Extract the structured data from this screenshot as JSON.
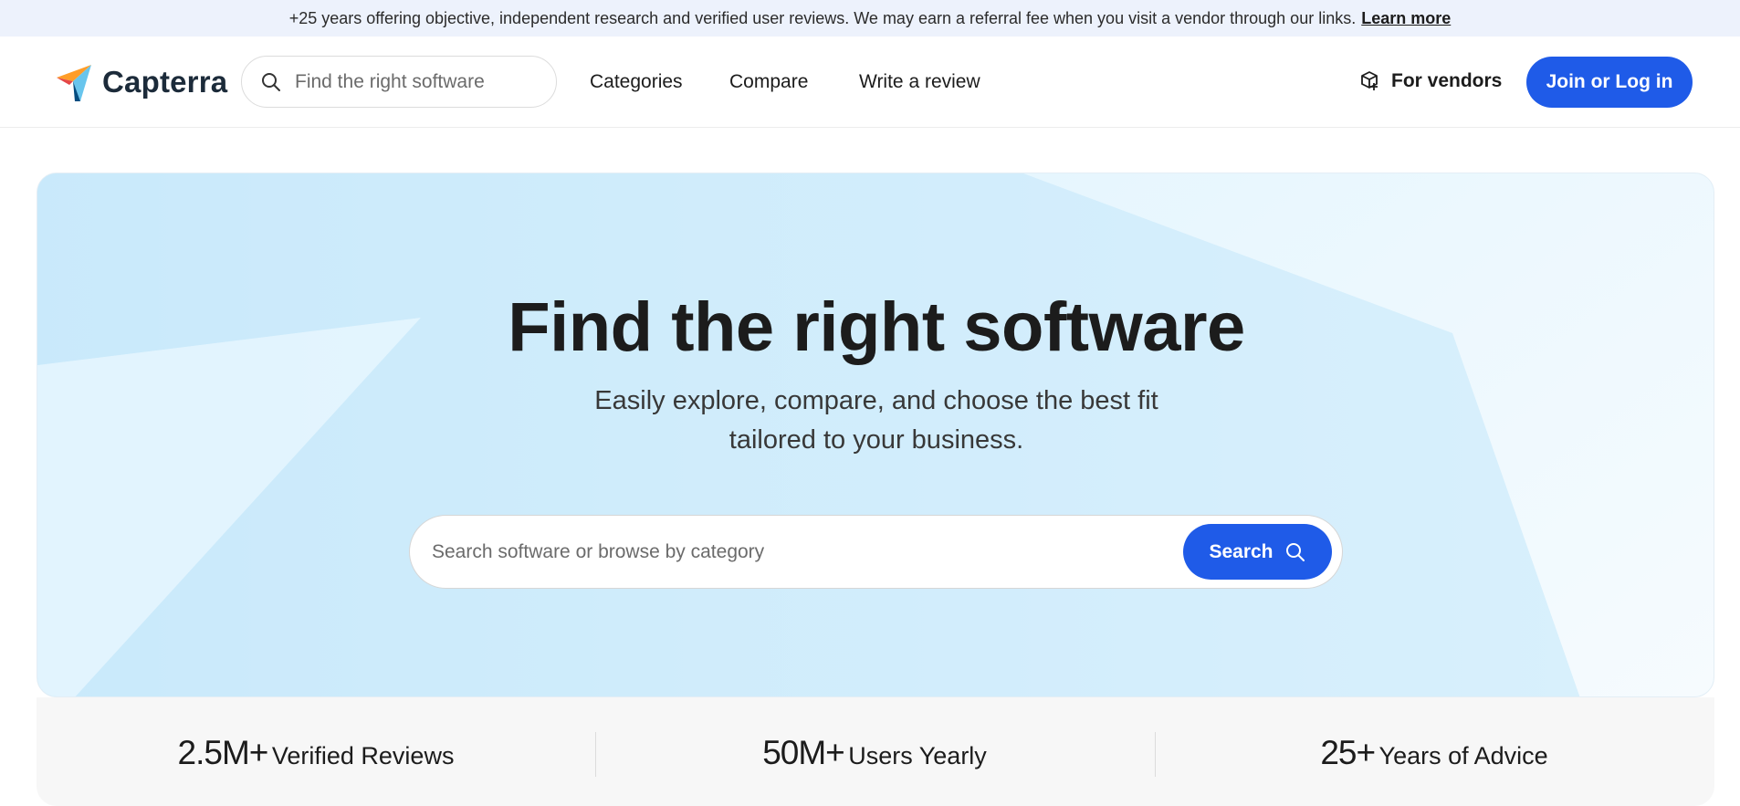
{
  "banner": {
    "text": "+25 years offering objective, independent research and verified user reviews. We may earn a referral fee when you visit a vendor through our links.",
    "link": "Learn more"
  },
  "header": {
    "brand": "Capterra",
    "search_placeholder": "Find the right software",
    "nav": [
      "Categories",
      "Compare",
      "Write a review"
    ],
    "vendors_label": "For vendors",
    "join_label": "Join or Log in"
  },
  "hero": {
    "title": "Find the right software",
    "subtitle_line1": "Easily explore, compare, and choose the best fit",
    "subtitle_line2": "tailored to your business.",
    "search_placeholder": "Search software or browse by category",
    "search_button": "Search"
  },
  "stats": [
    {
      "number": "2.5M+",
      "label": "Verified Reviews"
    },
    {
      "number": "50M+",
      "label": "Users Yearly"
    },
    {
      "number": "25+",
      "label": "Years of Advice"
    }
  ],
  "colors": {
    "accent": "#1f5be8",
    "banner_bg": "#edf2fc",
    "hero_bg": "#d8f0fd"
  }
}
